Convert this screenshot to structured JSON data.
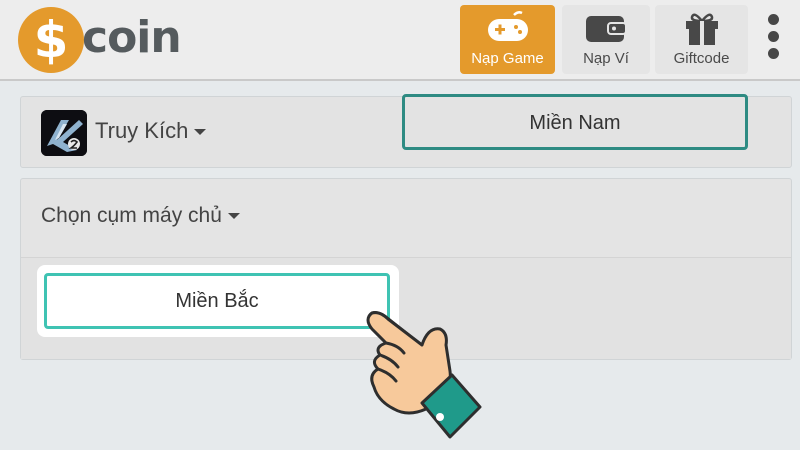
{
  "header": {
    "logo": {
      "symbol": "$",
      "text": "coin",
      "brand_color": "#e49a2c"
    },
    "nav": [
      {
        "label": "Nạp Game",
        "icon": "gamepad-icon",
        "active": true
      },
      {
        "label": "Nạp Ví",
        "icon": "wallet-icon",
        "active": false
      },
      {
        "label": "Giftcode",
        "icon": "gift-icon",
        "active": false
      }
    ],
    "more_icon": "kebab-menu-icon"
  },
  "game_selector": {
    "name": "Truy Kích",
    "icon": "game-truy-kich-icon"
  },
  "server_selector": {
    "title": "Chọn cụm máy chủ",
    "options": [
      {
        "label": "Miền Bắc",
        "highlighted": true
      },
      {
        "label": "Miền Nam",
        "highlighted": false
      }
    ],
    "accent_color": "#3fc3b3"
  },
  "pointer": {
    "icon": "pointing-hand-icon"
  }
}
